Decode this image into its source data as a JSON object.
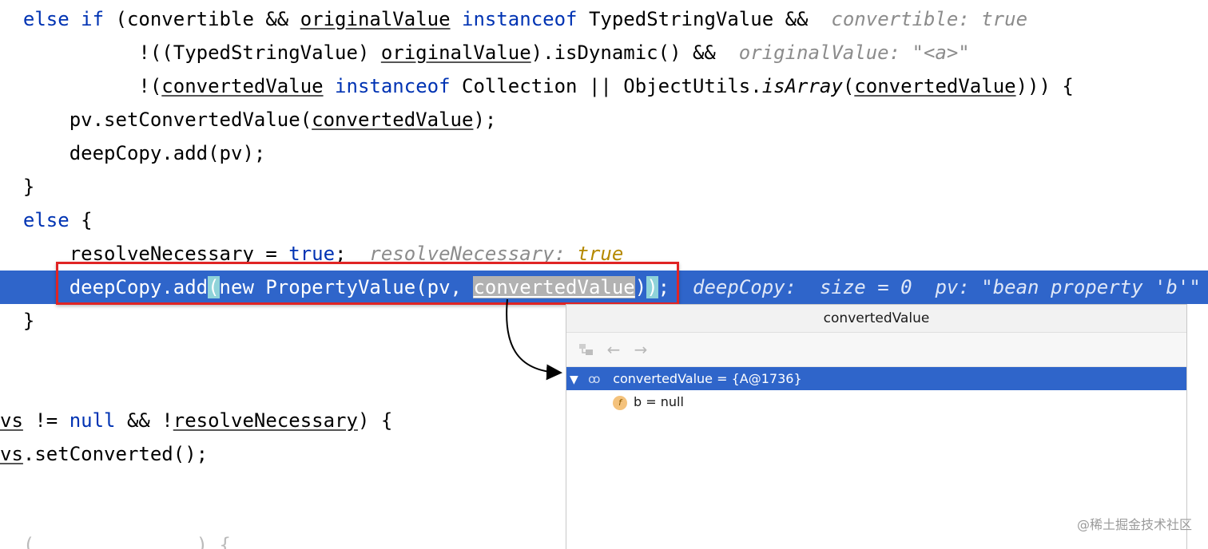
{
  "code": {
    "line1": {
      "kw_else": "else",
      "kw_if": "if",
      "p1": " (convertible && ",
      "u1": "originalValue",
      "sp1": " ",
      "kw_instanceof": "instanceof",
      "p2": " TypedStringValue &&",
      "hint": "convertible: true"
    },
    "line2": {
      "p1": "!((TypedStringValue) ",
      "u1": "originalValue",
      "p2": ").isDynamic() &&",
      "hint": "originalValue: \"<a>\""
    },
    "line3": {
      "p1": "!(",
      "u1": "convertedValue",
      "sp": " ",
      "kw_instanceof": "instanceof",
      "p2": " Collection || ObjectUtils.",
      "it1": "isArray",
      "p3": "(",
      "u2": "convertedValue",
      "p4": "))) {"
    },
    "line4": {
      "p1": "pv.setConvertedValue(",
      "u1": "convertedValue",
      "p2": ");"
    },
    "line5": {
      "text": "deepCopy.add(pv);"
    },
    "line6": {
      "text": "}"
    },
    "line7": {
      "kw_else": "else",
      "p1": " {"
    },
    "line8": {
      "p1": "resolveNecessary = ",
      "kw_true": "true",
      "p2": ";",
      "hint_name": "resolveNecessary:",
      "hint_val": "true"
    },
    "line9": {
      "p1": "deepCopy.add",
      "brace_open": "(",
      "kw_new": "new",
      "p2": " PropertyValue(pv, ",
      "sel": "convertedValue",
      "p3": ")",
      "brace_close": ")",
      "p4": ";",
      "hint": "deepCopy:  size = 0  pv: \"bean property 'b'\""
    },
    "line10": {
      "text": "}"
    },
    "line11": {
      "u1": "vs",
      "p1": " != ",
      "kw_null": "null",
      "p2": " && !",
      "u2": "resolveNecessary",
      "p3": ") {"
    },
    "line12": {
      "u1": "vs",
      "p1": ".setConverted();"
    },
    "line13": {
      "text": "  (              ) {"
    }
  },
  "popup": {
    "title": "convertedValue",
    "toolbar": {
      "icons": [
        "hierarchy-icon",
        "back-arrow-icon",
        "forward-arrow-icon"
      ],
      "back_glyph": "←",
      "forward_glyph": "→"
    },
    "tree": {
      "root_toggle": "▼",
      "root_icon": "oo",
      "root_label": "convertedValue = {A@1736}",
      "child_icon": "f",
      "child_label": "b = null"
    }
  },
  "watermark": "@稀土掘金技术社区",
  "colors": {
    "execution_line": "#2f65ca",
    "keyword": "#0033b3",
    "hint": "#8c8c8c",
    "annotation_box": "#e02424"
  }
}
